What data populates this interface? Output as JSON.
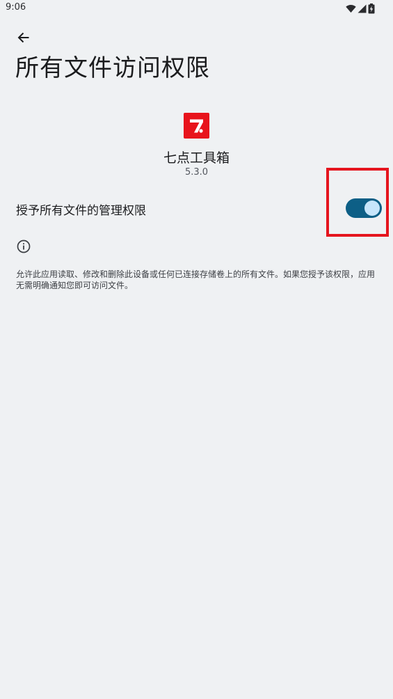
{
  "status_bar": {
    "time": "9:06",
    "icons": [
      "wifi-icon",
      "cellular-signal-icon",
      "battery-charging-icon"
    ]
  },
  "header": {
    "back_icon": "arrow-left-icon",
    "title": "所有文件访问权限"
  },
  "app": {
    "icon": "app-logo-icon",
    "icon_glyph": "7.",
    "icon_color": "#e8141c",
    "name": "七点工具箱",
    "version": "5.3.0"
  },
  "permission": {
    "label": "授予所有文件的管理权限",
    "enabled": true,
    "toggle_color": "#0d5f86"
  },
  "info": {
    "icon": "info-icon",
    "description": "允许此应用读取、修改和删除此设备或任何已连接存储卷上的所有文件。如果您授予该权限，应用无需明确通知您即可访问文件。"
  },
  "highlight_color": "#e5151e"
}
